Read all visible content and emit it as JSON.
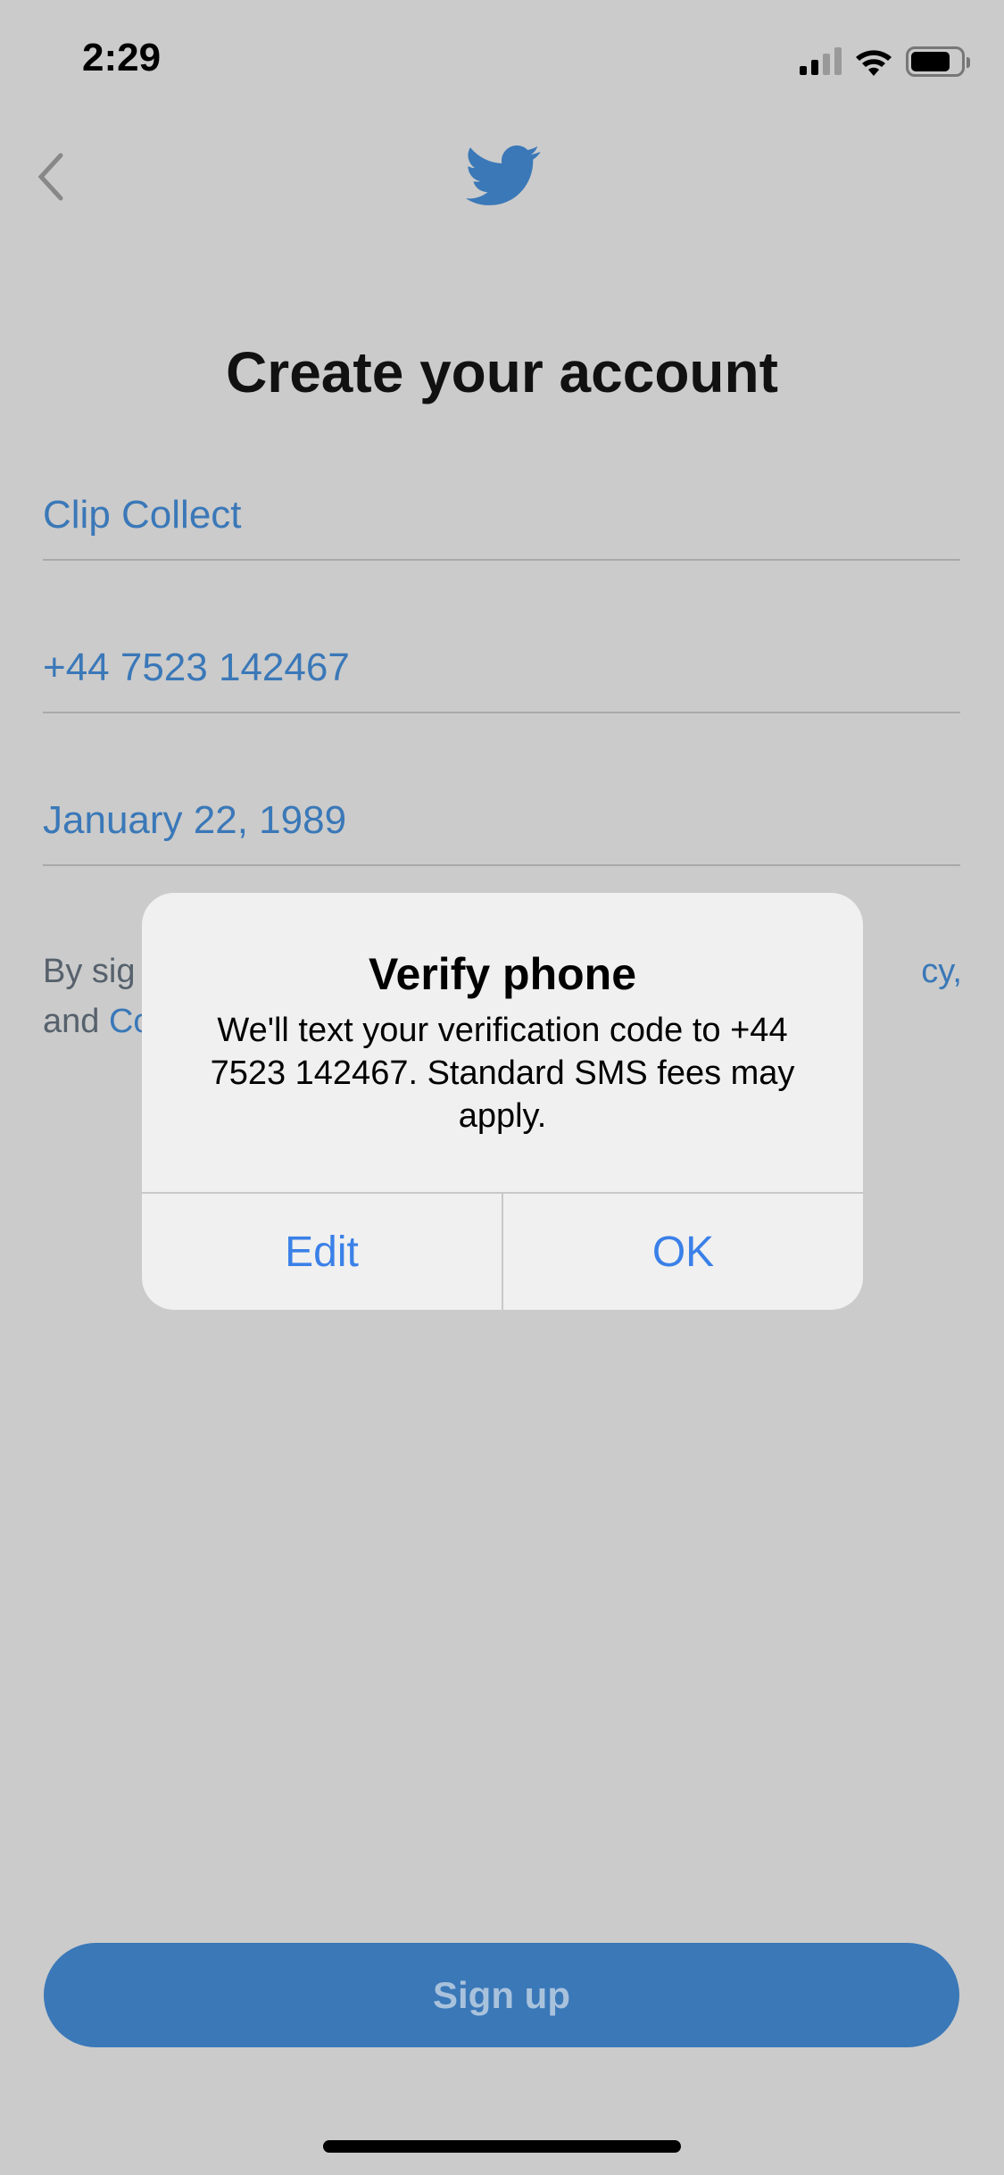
{
  "status_bar": {
    "time": "2:29",
    "signal_bars": 2,
    "signal_max": 4,
    "wifi": "wifi-icon",
    "battery_percent": 80
  },
  "header": {
    "back_icon": "chevron-left-icon",
    "logo": "twitter-bird-icon",
    "brand_color": "#3a78b8"
  },
  "title": "Create your account",
  "fields": [
    {
      "value": "Clip Collect"
    },
    {
      "value": "+44 7523 142467"
    },
    {
      "value": "January 22, 1989"
    }
  ],
  "terms": {
    "line1_start": "By sig",
    "line1_end": "cy,",
    "line2_start": "and ",
    "line2_link": "Co"
  },
  "dialog": {
    "title": "Verify phone",
    "message": "We'll text your verification code to +44 7523 142467. Standard SMS fees may apply.",
    "edit_label": "Edit",
    "ok_label": "OK"
  },
  "signup_label": "Sign up"
}
